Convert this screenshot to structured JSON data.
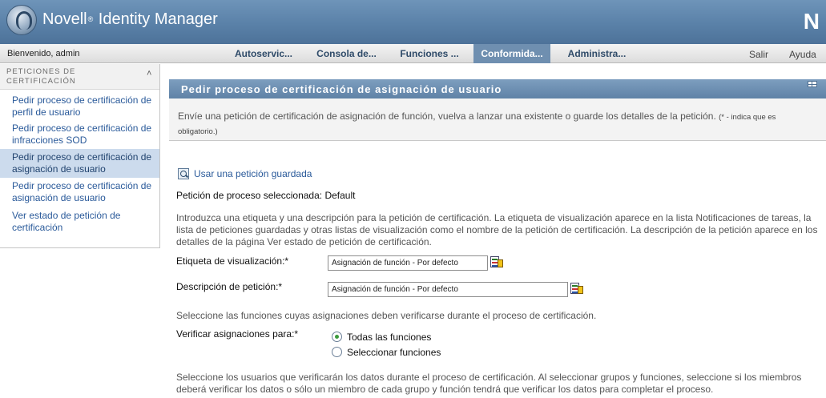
{
  "header": {
    "brand": "Novell",
    "brand_reg": "®",
    "product": "Identity Manager",
    "corner_logo": "N"
  },
  "nav": {
    "welcome": "Bienvenido, admin",
    "tabs": [
      {
        "label": "Autoservic...",
        "active": false
      },
      {
        "label": "Consola de...",
        "active": false
      },
      {
        "label": "Funciones ...",
        "active": false
      },
      {
        "label": "Conformida...",
        "active": true
      },
      {
        "label": "Administra...",
        "active": false
      }
    ],
    "logout": "Salir",
    "help": "Ayuda"
  },
  "sidebar": {
    "title": "PETICIONES DE CERTIFICACIÓN",
    "collapse_icon": "double-chevron-up-icon",
    "items": [
      {
        "label": "Pedir proceso de certificación de perfil de usuario",
        "selected": false
      },
      {
        "label": "Pedir proceso de certificación de infracciones SOD",
        "selected": false
      },
      {
        "label": "Pedir proceso de certificación de asignación de usuario",
        "selected": true
      },
      {
        "label": "Pedir proceso de certificación de asignación de usuario",
        "selected": false
      },
      {
        "label": "Ver estado de petición de certificación",
        "selected": false
      }
    ]
  },
  "main": {
    "title": "Pedir proceso de certificación de asignación de usuario",
    "intro": "Envíe una petición de certificación de asignación de función, vuelva a lanzar una existente o guarde los detalles de la petición.",
    "intro_required": "(* - indica que es obligatorio.)",
    "saved_request_link": "Usar una petición guardada",
    "selected_process": "Petición de proceso seleccionada: Default",
    "label_help": "Introduzca una etiqueta y una descripción para la petición de certificación. La etiqueta de visualización aparece en la lista Notificaciones de tareas, la lista de peticiones guardadas y otras listas de visualización como el nombre de la petición de certificación. La descripción de la petición aparece en los detalles de la página Ver estado de petición de certificación.",
    "display_label": {
      "label": "Etiqueta de visualización:*",
      "value": "Asignación de función - Por defecto"
    },
    "description": {
      "label": "Descripción de petición:*",
      "value": "Asignación de función - Por defecto"
    },
    "roles_help": "Seleccione las funciones cuyas asignaciones deben verificarse durante el proceso de certificación.",
    "verify_label": "Verificar asignaciones para:*",
    "verify_options": [
      {
        "label": "Todas las funciones",
        "checked": true
      },
      {
        "label": "Seleccionar funciones",
        "checked": false
      }
    ],
    "users_help": "Seleccione los usuarios que verificarán los datos durante el proceso de certificación. Al seleccionar grupos y funciones, seleccione si los miembros deberá verificar los datos o sólo un miembro de cada grupo y función tendrá que verificar los datos para completar el proceso."
  }
}
